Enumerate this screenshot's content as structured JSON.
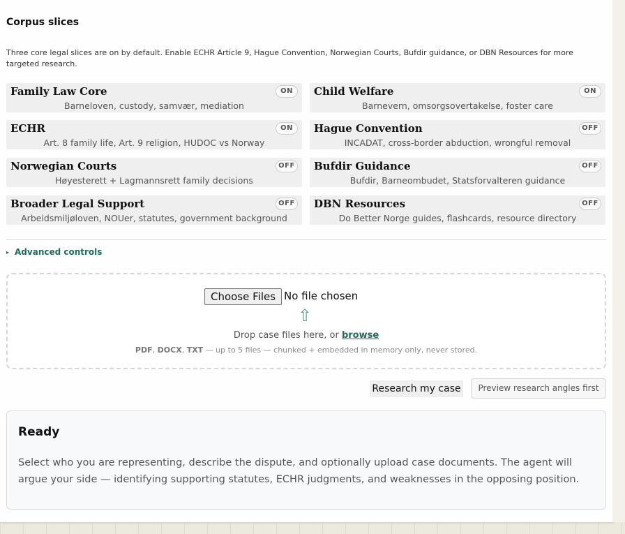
{
  "corpus": {
    "title": "Corpus slices",
    "description": "Three core legal slices are on by default. Enable ECHR Article 9, Hague Convention, Norwegian Courts, Bufdir guidance, or DBN Resources for more targeted research."
  },
  "slices": [
    {
      "title": "Family Law Core",
      "subtitle": "Barneloven, custody, samvær, mediation",
      "state": "ON"
    },
    {
      "title": "Child Welfare",
      "subtitle": "Barnevern, omsorgsovertakelse, foster care",
      "state": "ON"
    },
    {
      "title": "ECHR",
      "subtitle": "Art. 8 family life, Art. 9 religion, HUDOC vs Norway",
      "state": "ON"
    },
    {
      "title": "Hague Convention",
      "subtitle": "INCADAT, cross-border abduction, wrongful removal",
      "state": "OFF"
    },
    {
      "title": "Norwegian Courts",
      "subtitle": "Høyesterett + Lagmannsrett family decisions",
      "state": "OFF"
    },
    {
      "title": "Bufdir Guidance",
      "subtitle": "Bufdir, Barneombudet, Statsforvalteren guidance",
      "state": "OFF"
    },
    {
      "title": "Broader Legal Support",
      "subtitle": "Arbeidsmiljøloven, NOUer, statutes, government background",
      "state": "OFF"
    },
    {
      "title": "DBN Resources",
      "subtitle": "Do Better Norge guides, flashcards, resource directory",
      "state": "OFF"
    }
  ],
  "advanced": {
    "label": "Advanced controls"
  },
  "upload": {
    "choose_label": "Choose Files",
    "no_file": "No file chosen",
    "drop_text": "Drop case files here, or",
    "browse": "browse",
    "fmt1": "PDF",
    "sep1": ", ",
    "fmt2": "DOCX",
    "sep2": ", ",
    "fmt3": "TXT",
    "hint_rest": " — up to 5 files — chunked + embedded in memory only, never stored."
  },
  "actions": {
    "research": "Research my case",
    "preview": "Preview research angles first"
  },
  "status": {
    "title": "Ready",
    "body": "Select who you are representing, describe the dispute, and optionally upload case documents. The agent will argue your side — identifying supporting statutes, ECHR judgments, and weaknesses in the opposing position."
  }
}
